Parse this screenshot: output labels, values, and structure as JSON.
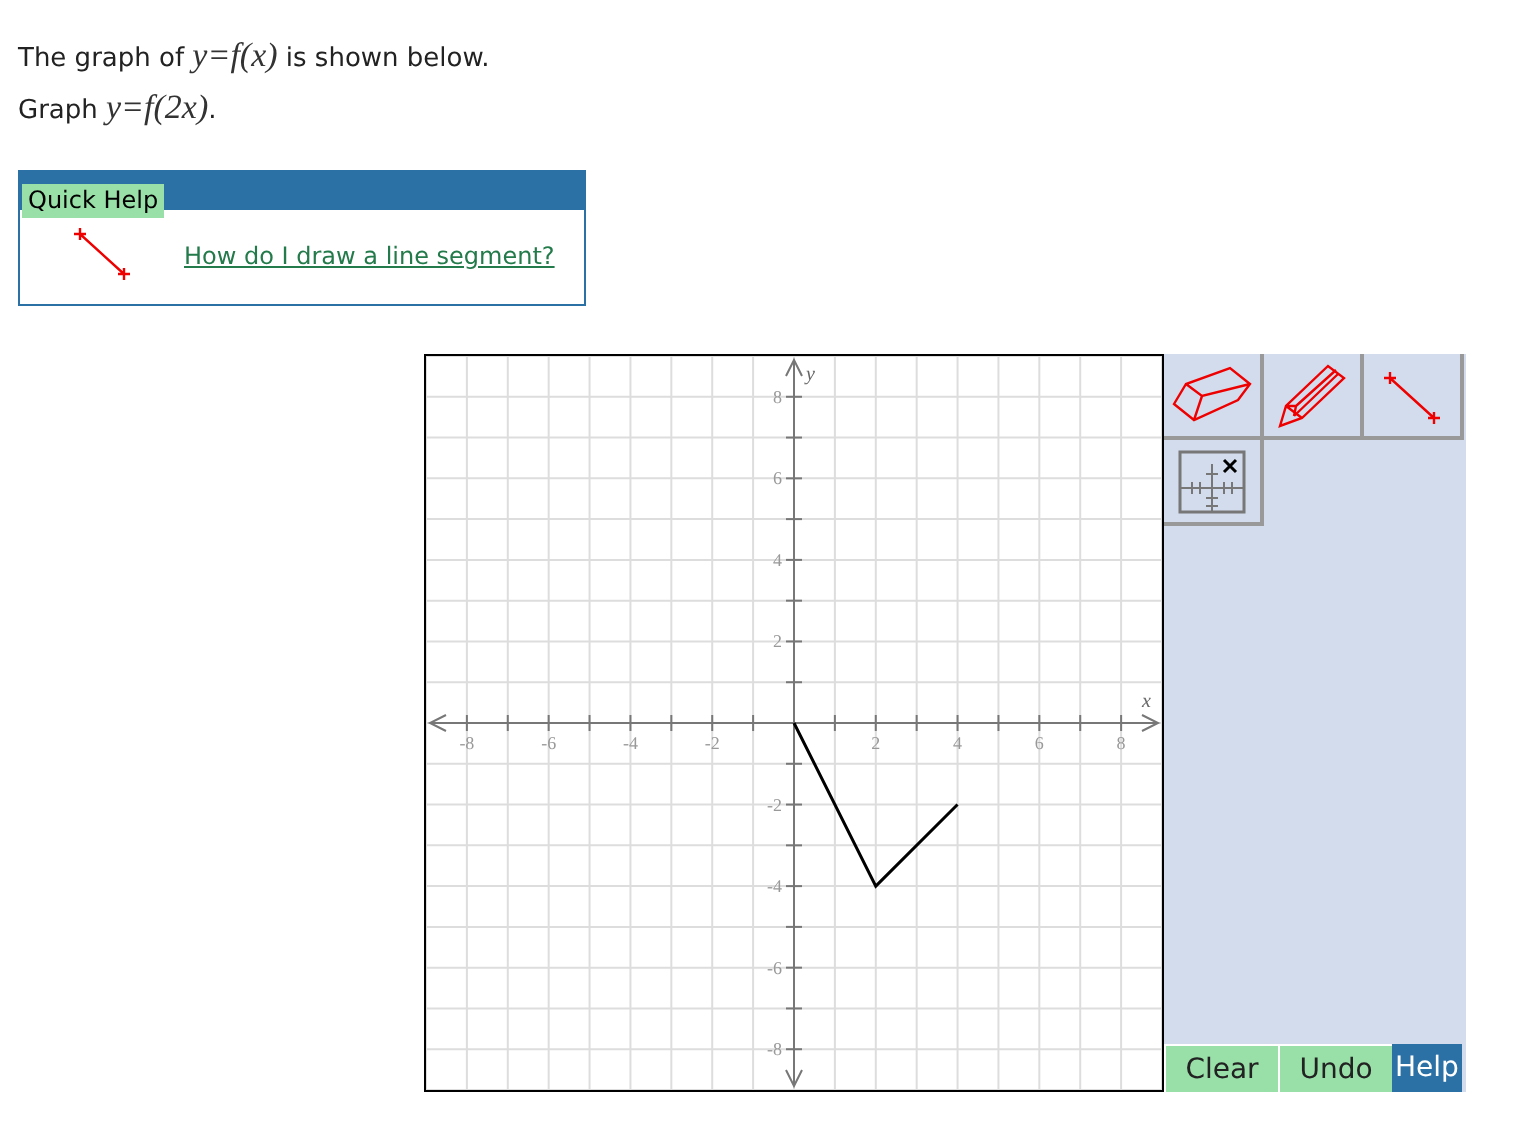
{
  "prompt": [
    {
      "lines": [
        {
          "kind": "text",
          "text": "The graph of "
        },
        {
          "kind": "math",
          "text": "y=f(x)"
        },
        {
          "kind": "text",
          "text": " is shown below."
        }
      ]
    },
    {
      "lines": [
        {
          "kind": "text",
          "text": "Graph "
        },
        {
          "kind": "math",
          "text": "y=f(2x)"
        },
        {
          "kind": "text",
          "text": "."
        }
      ]
    }
  ],
  "quick_help": {
    "title": "Quick Help",
    "link": "How do I draw a line segment?"
  },
  "graph": {
    "chart_data": {
      "type": "line",
      "xlabel": "x",
      "ylabel": "y",
      "xlim": [
        -9,
        9
      ],
      "ylim": [
        -9,
        9
      ],
      "xticks": [
        -8,
        -6,
        -4,
        -2,
        2,
        4,
        6,
        8
      ],
      "yticks": [
        -8,
        -6,
        -4,
        -2,
        2,
        4,
        6,
        8
      ],
      "grid": true,
      "x": [
        0,
        2,
        4
      ],
      "series": [
        {
          "color": "#000000",
          "values": [
            0,
            -4,
            -2
          ]
        }
      ]
    }
  },
  "tools": [
    {
      "kind": "eraser"
    },
    {
      "kind": "pencil"
    },
    {
      "kind": "segment"
    },
    {
      "kind": "grid"
    }
  ],
  "buttons": [
    {
      "kind": "action",
      "label": "Clear"
    },
    {
      "kind": "action",
      "label": "Undo"
    },
    {
      "kind": "help",
      "label": "Help"
    }
  ]
}
